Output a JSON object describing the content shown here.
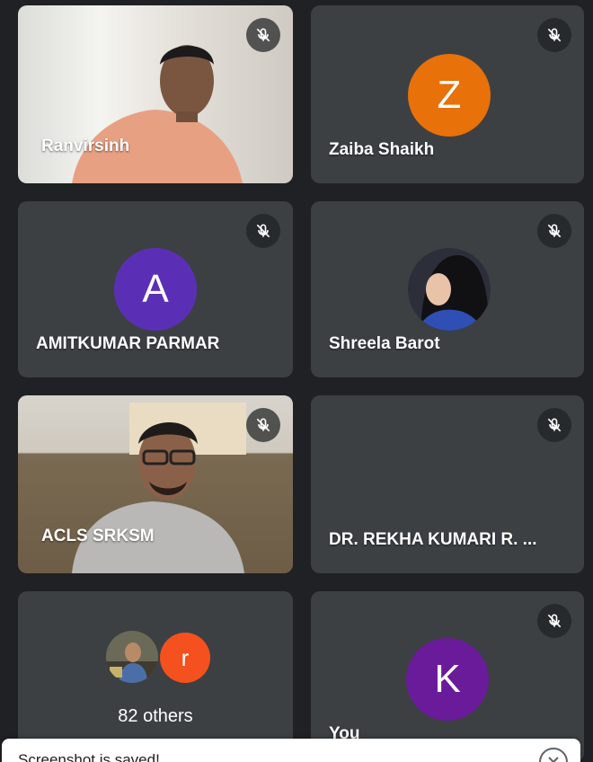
{
  "participants": [
    {
      "name": "Ranvirsinh",
      "type": "video",
      "muted": true
    },
    {
      "name": "Zaiba Shaikh",
      "type": "initial",
      "initial": "Z",
      "color": "#e8710a",
      "muted": true
    },
    {
      "name": "AMITKUMAR PARMAR",
      "type": "initial",
      "initial": "A",
      "color": "#5b2fb5",
      "muted": true
    },
    {
      "name": "Shreela Barot",
      "type": "photo",
      "muted": true
    },
    {
      "name": "ACLS SRKSM",
      "type": "video",
      "muted": true
    },
    {
      "name": "DR. REKHA KUMARI R. ...",
      "type": "blank",
      "muted": true
    },
    {
      "name": "82 others",
      "type": "group",
      "group_initial": "r",
      "group_color": "#f4511e"
    },
    {
      "name": "You",
      "type": "initial",
      "initial": "K",
      "color": "#6a1b9a",
      "muted": true
    }
  ],
  "toast": {
    "message": "Screenshot is saved!"
  },
  "colors": {
    "background": "#202124",
    "tile": "#3c4043"
  }
}
